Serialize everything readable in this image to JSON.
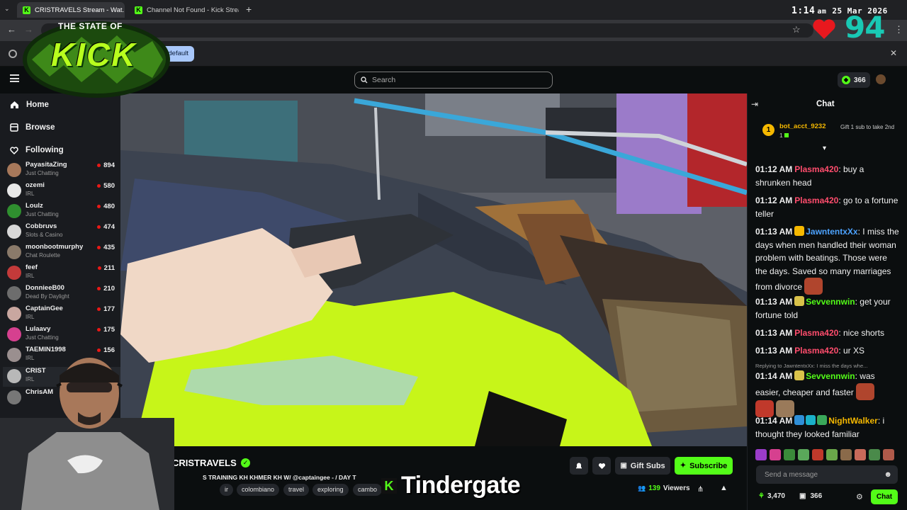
{
  "browser": {
    "tabs": [
      {
        "label": "CRISTRAVELS Stream - Wat...",
        "active": true
      },
      {
        "label": "Channel Not Found - Kick Strea",
        "active": false
      }
    ],
    "infobar_chip": "s.default"
  },
  "overlay": {
    "time": "1:14",
    "ampm": "am",
    "date": "25 Mar 2026",
    "heart_count": "94",
    "logo_line1": "THE STATE OF",
    "logo_line2": "KICK",
    "ticker_text": "Tindergate"
  },
  "nav": {
    "search_placeholder": "Search",
    "points": "366"
  },
  "sidebar": {
    "items": [
      {
        "label": "Home",
        "icon": "home-icon"
      },
      {
        "label": "Browse",
        "icon": "browse-icon"
      },
      {
        "label": "Following",
        "icon": "heart-icon"
      }
    ],
    "channels": [
      {
        "name": "PayasitaZing",
        "category": "Just Chatting",
        "viewers": "894",
        "color": "#a7785a"
      },
      {
        "name": "ozemi",
        "category": "IRL",
        "viewers": "580",
        "color": "#e8e8e8"
      },
      {
        "name": "Loulz",
        "category": "Just Chatting",
        "viewers": "480",
        "color": "#2f8f2f"
      },
      {
        "name": "Cobbruvs",
        "category": "Slots & Casino",
        "viewers": "474",
        "color": "#d8d8d8"
      },
      {
        "name": "moonbootmurphy",
        "category": "Chat Roulette",
        "viewers": "435",
        "color": "#8a7a6a"
      },
      {
        "name": "feef",
        "category": "IRL",
        "viewers": "211",
        "color": "#c33a3a"
      },
      {
        "name": "DonnieeB00",
        "category": "Dead By Daylight",
        "viewers": "210",
        "color": "#6d6d6d"
      },
      {
        "name": "CaptainGee",
        "category": "IRL",
        "viewers": "177",
        "color": "#c9a7a0"
      },
      {
        "name": "Lulaavy",
        "category": "Just Chatting",
        "viewers": "175",
        "color": "#d6408f"
      },
      {
        "name": "TAEMIN1998",
        "category": "IRL",
        "viewers": "156",
        "color": "#9a8f8f"
      },
      {
        "name": "CRIST",
        "category": "IRL",
        "viewers": "",
        "color": "#b8b8b8"
      },
      {
        "name": "ChrisAM",
        "category": "",
        "viewers": "",
        "color": "#777777"
      }
    ]
  },
  "stream": {
    "streamer": "CRISTRAVELS",
    "title": "S TRAINING KH KHMER KH W/ @captaingee - / DAY T",
    "tags": [
      "colombiano",
      "travel",
      "exploring",
      "cambo"
    ],
    "tag_prefix": "ir",
    "viewers_count": "139",
    "viewers_label": "Viewers",
    "gift_subs_label": "Gift Subs",
    "subscribe_label": "Subscribe"
  },
  "chat": {
    "header": "Chat",
    "pinned_user": "bot_acct_9232",
    "pinned_rank": "1",
    "pinned_sub": "1",
    "pinned_text": "Gift 1 sub to take 2nd",
    "reply_preview": "Replying to JawntentxXx: I miss the days whe...",
    "messages": [
      {
        "time": "01:12 AM",
        "user": "Plasma420",
        "color": "#ff4d6d",
        "text": "buy a shrunken head"
      },
      {
        "time": "01:12 AM",
        "user": "Plasma420",
        "color": "#ff4d6d",
        "text": "go to a fortune teller"
      },
      {
        "time": "01:13 AM",
        "user": "JawntentxXx",
        "color": "#4da3ff",
        "text": "I miss the days when men handled their woman problem with beatings. Those were the days. Saved so many marriages from divorce"
      },
      {
        "time": "01:13 AM",
        "user": "Sevvennwin",
        "color": "#53fc18",
        "text": "get your fortune told"
      },
      {
        "time": "01:13 AM",
        "user": "Plasma420",
        "color": "#ff4d6d",
        "text": "nice shorts"
      },
      {
        "time": "01:13 AM",
        "user": "Plasma420",
        "color": "#ff4d6d",
        "text": "ur XS"
      },
      {
        "time": "01:14 AM",
        "user": "Sevvennwin",
        "color": "#53fc18",
        "text": "was easier, cheaper and faster"
      },
      {
        "time": "01:14 AM",
        "user": "NightWalker",
        "color": "#f5b800",
        "text": "i thought they looked familiar"
      }
    ],
    "input_placeholder": "Send a message",
    "footer_points": "3,470",
    "footer_count": "366",
    "chat_button": "Chat"
  }
}
